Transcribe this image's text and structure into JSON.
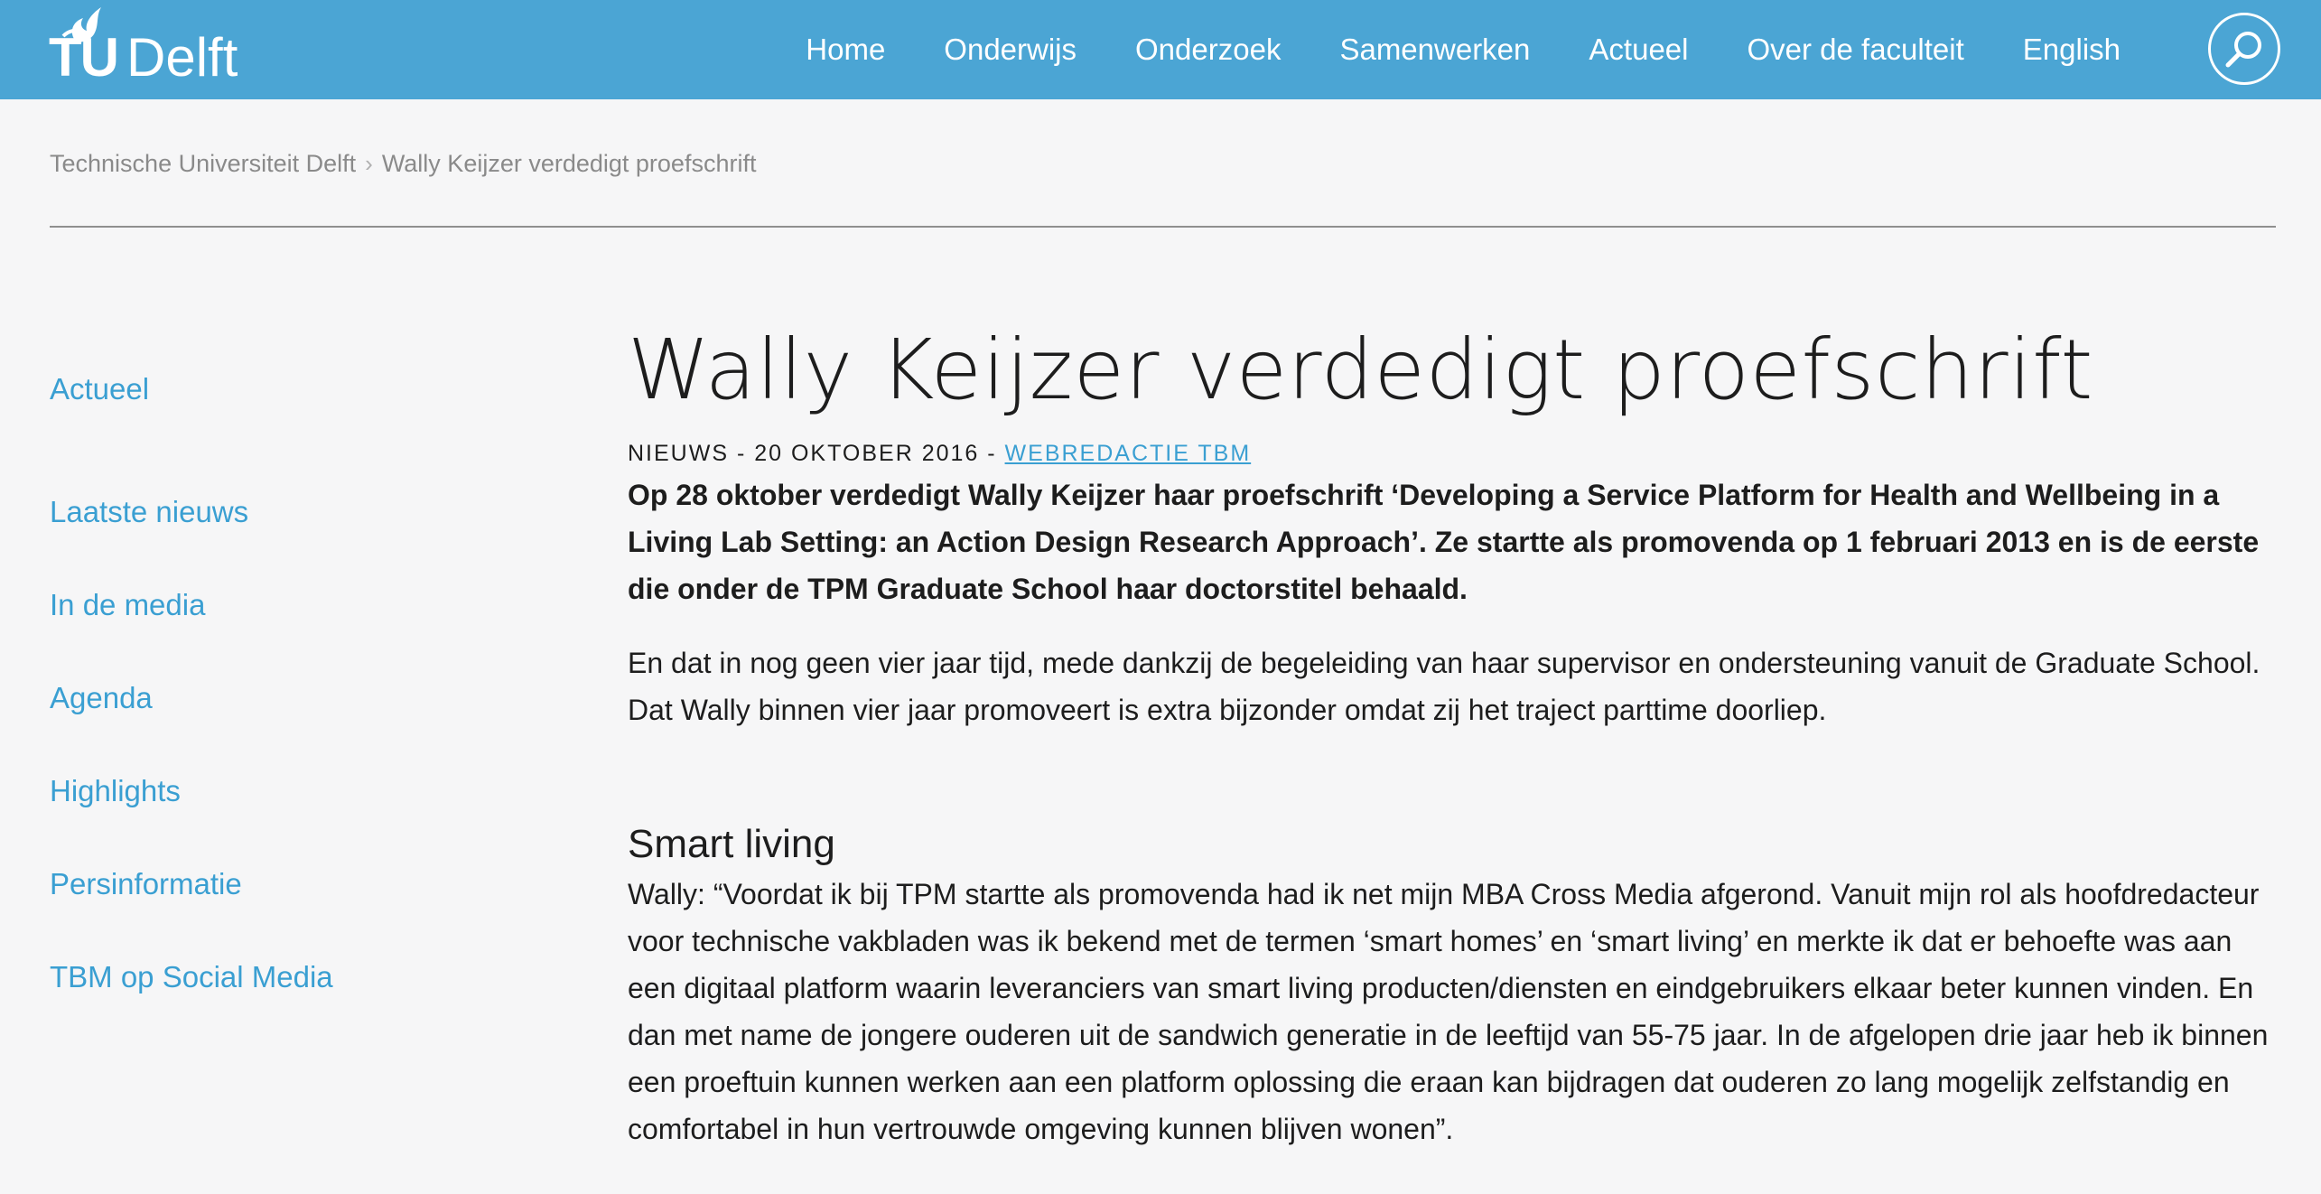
{
  "header": {
    "logo_tu": "TU",
    "logo_delft": "Delft",
    "nav": [
      "Home",
      "Onderwijs",
      "Onderzoek",
      "Samenwerken",
      "Actueel",
      "Over de faculteit",
      "English"
    ],
    "search_icon": "search-icon",
    "background_color": "#4ba5d4"
  },
  "breadcrumb": {
    "items": [
      "Technische Universiteit Delft",
      "Wally Keijzer verdedigt proefschrift"
    ],
    "separator": "›"
  },
  "sidebar": {
    "items": [
      "Actueel",
      "Laatste nieuws",
      "In de media",
      "Agenda",
      "Highlights",
      "Persinformatie",
      "TBM op Social Media"
    ],
    "link_color": "#3a9fd2"
  },
  "article": {
    "title": "Wally Keijzer verdedigt proefschrift",
    "meta_prefix": "NIEUWS - 20 OKTOBER 2016 - ",
    "meta_author": "WEBREDACTIE TBM",
    "lead": "Op 28 oktober verdedigt Wally Keijzer haar proefschrift ‘Developing a Service Platform for Health and Wellbeing in a Living Lab Setting: an Action Design Research Approach’. Ze startte als promovenda op 1 februari 2013 en is de eerste die onder de TPM Graduate School haar doctorstitel behaald.",
    "paragraph1": "En dat in nog geen vier jaar tijd, mede dankzij de begeleiding van haar supervisor en ondersteuning vanuit de Graduate School. Dat Wally binnen vier jaar promoveert is extra bijzonder omdat zij het traject parttime doorliep.",
    "heading2": "Smart living",
    "paragraph2": "Wally: “Voordat ik bij TPM startte als promovenda had ik net mijn MBA Cross Media afgerond. Vanuit mijn rol als hoofdredacteur voor technische vakbladen was ik bekend met de termen ‘smart homes’ en ‘smart living’ en merkte ik dat er behoefte was aan een digitaal platform waarin leveranciers van smart living producten/diensten en eindgebruikers elkaar beter kunnen vinden. En dan met name de jongere ouderen uit de sandwich generatie in de leeftijd van 55-75 jaar. In de afgelopen drie jaar heb ik binnen een proeftuin kunnen werken aan een platform oplossing die eraan kan bijdragen dat ouderen zo lang mogelijk zelfstandig en comfortabel in hun vertrouwde omgeving kunnen blijven wonen”."
  }
}
